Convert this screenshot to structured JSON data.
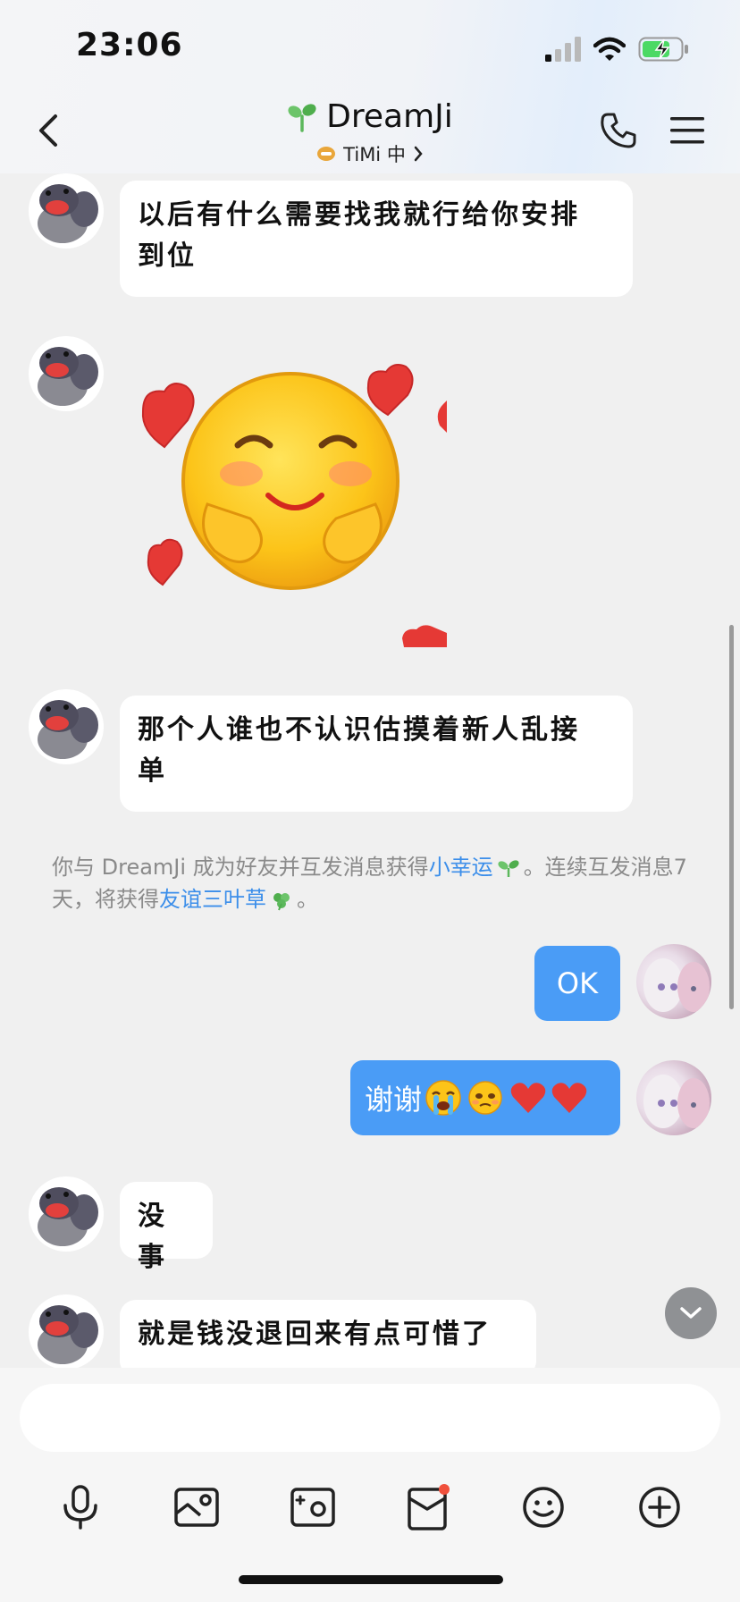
{
  "status_bar": {
    "time": "23:06"
  },
  "header": {
    "title": "DreamJi",
    "subtitle": "TiMi 中",
    "icons": [
      "back-arrow-icon",
      "sprout-icon",
      "timi-badge-icon",
      "chevron-right-icon",
      "phone-icon",
      "menu-icon"
    ]
  },
  "messages": [
    {
      "side": "in",
      "text_line1": "以后有什么需要找我就行给你安排",
      "text_line2": "到位"
    },
    {
      "side": "in",
      "type": "sticker",
      "sticker": "blushing-emoji-hearts"
    },
    {
      "side": "in",
      "text_line1": "那个人谁也不认识估摸着新人乱接",
      "text_line2": "单"
    },
    {
      "side": "out",
      "text": "OK"
    },
    {
      "side": "out",
      "text": "谢谢",
      "emojis": "😭🥺❤️❤️"
    },
    {
      "side": "in",
      "text": "没事"
    },
    {
      "side": "in",
      "text": "就是钱没退回来有点可惜了"
    }
  ],
  "system_notice": {
    "prefix": "你与 DreamJi 成为好友并互发消息获得",
    "link1": "小幸运",
    "middle": "。连续互发消息7天，将获得",
    "link2": "友谊三叶草",
    "suffix": "。"
  },
  "colors": {
    "accent_blue": "#4a9cf6",
    "link_blue": "#3b8eea",
    "badge_red": "#f0503c",
    "sprout_green": "#5cb85c"
  },
  "toolbar": {
    "items": [
      "microphone-icon",
      "image-icon",
      "camera-icon",
      "red-packet-icon",
      "emoji-icon",
      "plus-icon"
    ]
  }
}
